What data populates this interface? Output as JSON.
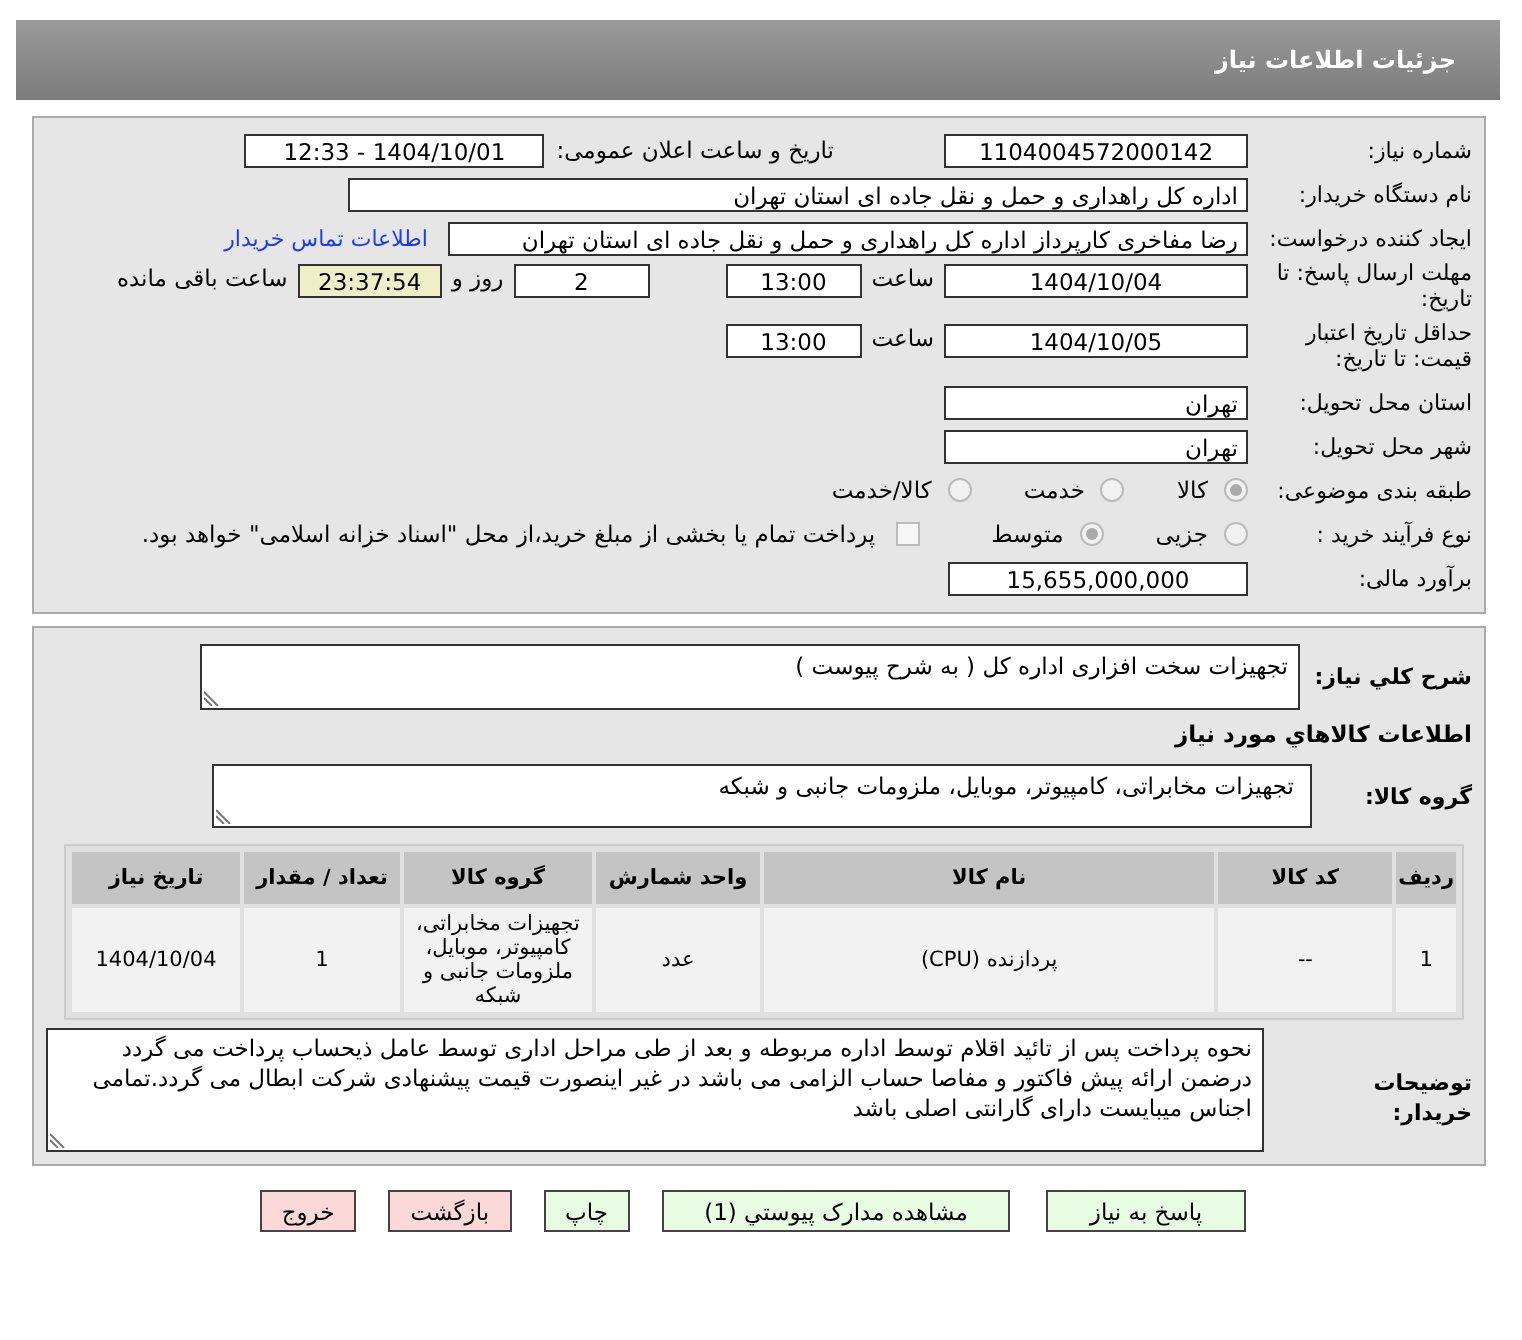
{
  "header": {
    "title": "جزئیات اطلاعات نیاز"
  },
  "need_number": {
    "label": "شماره نیاز:",
    "value": "1104004572000142"
  },
  "announce": {
    "label": "تاریخ و ساعت اعلان عمومی:",
    "value": "1404/10/01 - 12:33"
  },
  "buyer": {
    "label": "نام دستگاه خریدار:",
    "value": "اداره کل راهداری و حمل و نقل جاده ای استان تهران"
  },
  "requester": {
    "label": "ایجاد کننده درخواست:",
    "value": "رضا مفاخری کارپرداز اداره کل راهداری و حمل و نقل جاده ای استان تهران",
    "link": "اطلاعات تماس خریدار"
  },
  "reply_deadline": {
    "label": "مهلت ارسال پاسخ: تا تاریخ:",
    "date": "1404/10/04",
    "time_label": "ساعت",
    "time": "13:00",
    "days": "2",
    "days_label": "روز و",
    "remaining": "23:37:54",
    "remaining_label": "ساعت باقی مانده"
  },
  "price_validity": {
    "label": "حداقل تاریخ اعتبار قیمت: تا تاریخ:",
    "date": "1404/10/05",
    "time_label": "ساعت",
    "time": "13:00"
  },
  "province": {
    "label": "استان محل تحویل:",
    "value": "تهران"
  },
  "city": {
    "label": "شهر محل تحویل:",
    "value": "تهران"
  },
  "category": {
    "label": "طبقه بندی موضوعی:",
    "options": [
      {
        "label": "کالا",
        "selected": true
      },
      {
        "label": "خدمت",
        "selected": false
      },
      {
        "label": "کالا/خدمت",
        "selected": false
      }
    ]
  },
  "process": {
    "label": "نوع فرآیند خرید :",
    "options": [
      {
        "label": "جزیی",
        "selected": false
      },
      {
        "label": "متوسط",
        "selected": true
      }
    ],
    "treasury": {
      "label": "پرداخت تمام یا بخشی از مبلغ خرید،از محل \"اسناد خزانه اسلامی\" خواهد بود.",
      "checked": false
    }
  },
  "budget": {
    "label": "برآورد مالی:",
    "value": "15,655,000,000"
  },
  "description": {
    "label": "شرح كلي نياز:",
    "value": "تجهیزات سخت افزاری اداره کل ( به شرح پیوست )"
  },
  "goods_title": "اطلاعات كالاهاي مورد نياز",
  "goods_group": {
    "label": "گروه کالا:",
    "value": "تجهیزات مخابراتی، کامپیوتر، موبایل، ملزومات جانبی و شبکه"
  },
  "table": {
    "columns": [
      "ردیف",
      "کد کالا",
      "نام کالا",
      "واحد شمارش",
      "گروه کالا",
      "تعداد / مقدار",
      "تاریخ نیاز"
    ],
    "rows": [
      [
        "1",
        "--",
        "پردازنده (CPU)",
        "عدد",
        "تجهیزات مخابراتی، کامپیوتر، موبایل، ملزومات جانبی و شبکه",
        "1",
        "1404/10/04"
      ]
    ]
  },
  "buyer_notes": {
    "label": "توضیحات خریدار:",
    "value": "نحوه پرداخت پس از تائید اقلام توسط اداره مربوطه و بعد از طی مراحل اداری توسط عامل ذیحساب پرداخت می گردد درضمن ارائه پیش فاکتور و مفاصا حساب الزامی می باشد در غیر اینصورت قیمت پیشنهادی شرکت ابطال می گردد.تمامی اجناس میبایست دارای گارانتی اصلی باشد"
  },
  "buttons": [
    {
      "label": "پاسخ به نیاز",
      "kind": "go"
    },
    {
      "label": "مشاهده مدارک پیوستي (1)",
      "kind": "go"
    },
    {
      "label": "چاپ",
      "kind": "go"
    },
    {
      "label": "بازگشت",
      "kind": "stop"
    },
    {
      "label": "خروج",
      "kind": "stop"
    }
  ]
}
